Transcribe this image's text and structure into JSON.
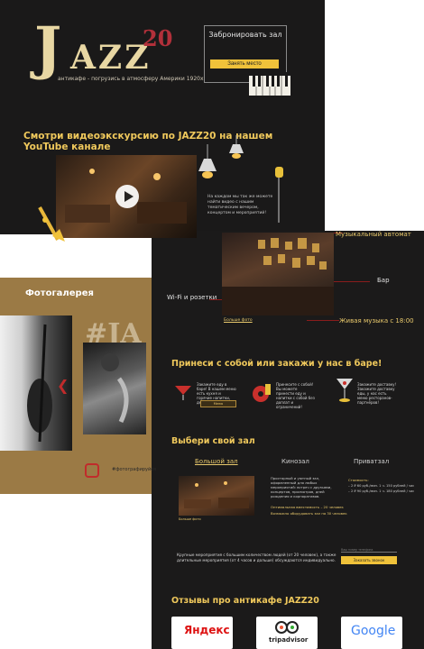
{
  "logo": {
    "j": "J",
    "azz": "AZZ",
    "num": "20"
  },
  "tagline": "антикафе - погрузись в атмосферу Америки 1920х",
  "booking": {
    "title": "Забронировать зал",
    "button": "Занять место"
  },
  "video": {
    "title": "Смотри видеоэкскурсию по JAZZ20 на нашем YouTube канале",
    "note": "На каждом мы так же можете найти видео с нашим тематическим вечером, концертом и мероприятий!"
  },
  "features": {
    "music_auto": "Музыкальный автомат",
    "wifi": "Wi-Fi и розетки",
    "bar": "Бар",
    "live_music": "Живая музыка с 18:00",
    "more_photos": "Больше фото"
  },
  "gallery": {
    "title": "Фотогалерея",
    "hashtag": "#JA",
    "insta_label": "#фотографируйся"
  },
  "bring": {
    "title": "Принеси с собой или закажи у нас в баре!",
    "offers": [
      {
        "text": "Закажите еду в баре! В нашем меню есть кухня и горячие напитки, дегустация вина.",
        "button": "Меню"
      },
      {
        "text": "Принесите с собой! Вы можете принести еду и напитки с собой без доплат и ограничений!"
      },
      {
        "text": "Закажите доставку! Закажите доставку еды, у нас есть меню ресторанов-партнёров!"
      }
    ]
  },
  "choose": {
    "title": "Выбери свой зал",
    "tabs": [
      "Большой зал",
      "Кинозал",
      "Приватзал"
    ],
    "info": "Просторный и уютный зал, оформленный для любых мероприятий: встреч с друзьями, концертов, просмотров, дней рождения и корпоративов.",
    "capacity": "Оптимальная вместимость – 20 человек",
    "capacity2": "Возможно оборудовать зал на 30 человек",
    "price_title": "Стоимость:",
    "prices": [
      "– 2 ₽ 60 руб./мин. 1 ч. 150 рублей / час",
      "– 2 ₽ 90 руб./мин. 1 ч. 180 рублей / час"
    ],
    "more": "Больше фото"
  },
  "events": {
    "note": "Крупные мероприятия с большим количеством людей (от 20 человек), а также длительные мероприятия (от 4 часов и дольше) обсуждаются индивидуально.",
    "input_placeholder": "Ваш номер телефона",
    "button": "Заказать звонок"
  },
  "reviews": {
    "title": "Отзывы про антикафе JAZZ20",
    "yandex": "Яндекс",
    "tripadvisor": "tripadvisor",
    "google": "Google"
  }
}
